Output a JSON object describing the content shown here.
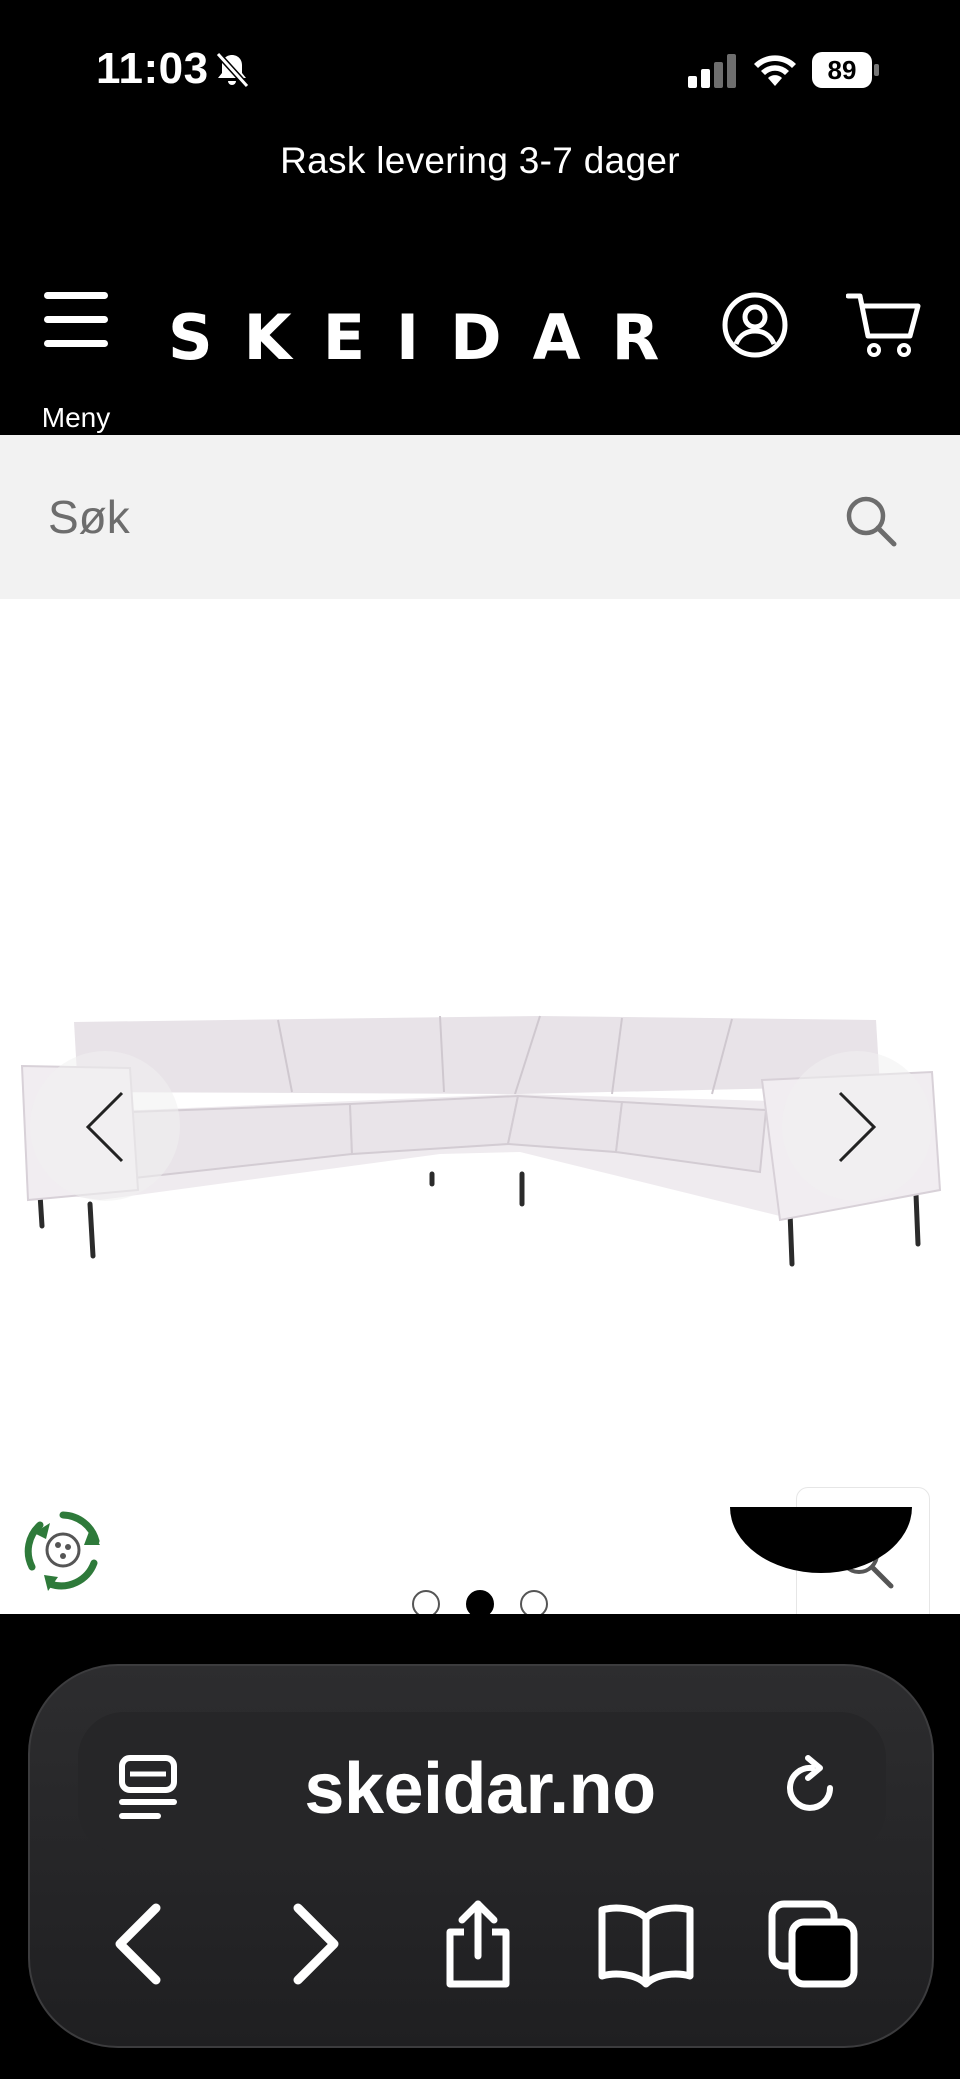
{
  "status_bar": {
    "time": "11:03",
    "battery": "89",
    "icons": [
      "bell-muted-icon",
      "cellular-signal-icon",
      "wifi-icon",
      "battery-icon"
    ]
  },
  "promo": {
    "text": "Rask levering 3-7 dager"
  },
  "header": {
    "menu_label": "Meny",
    "logo": "SKEIDAR",
    "icons": [
      "hamburger-icon",
      "account-icon",
      "cart-icon"
    ]
  },
  "search": {
    "placeholder": "Søk",
    "icon": "search-icon"
  },
  "product_gallery": {
    "image": "corner-sofa",
    "slide_count": 3,
    "active_slide": 2,
    "icons": [
      "chevron-left-icon",
      "chevron-right-icon",
      "eco-icon",
      "zoom-icon"
    ]
  },
  "browser": {
    "url": "skeidar.no",
    "icons": [
      "reader-icon",
      "reload-icon",
      "back-icon",
      "forward-icon",
      "share-icon",
      "bookmarks-icon",
      "tabs-icon"
    ]
  },
  "colors": {
    "header_bg": "#000000",
    "search_bg": "#f2f2f2",
    "sofa": "#ece8ec",
    "browser_panel": "#2a2a2c"
  }
}
